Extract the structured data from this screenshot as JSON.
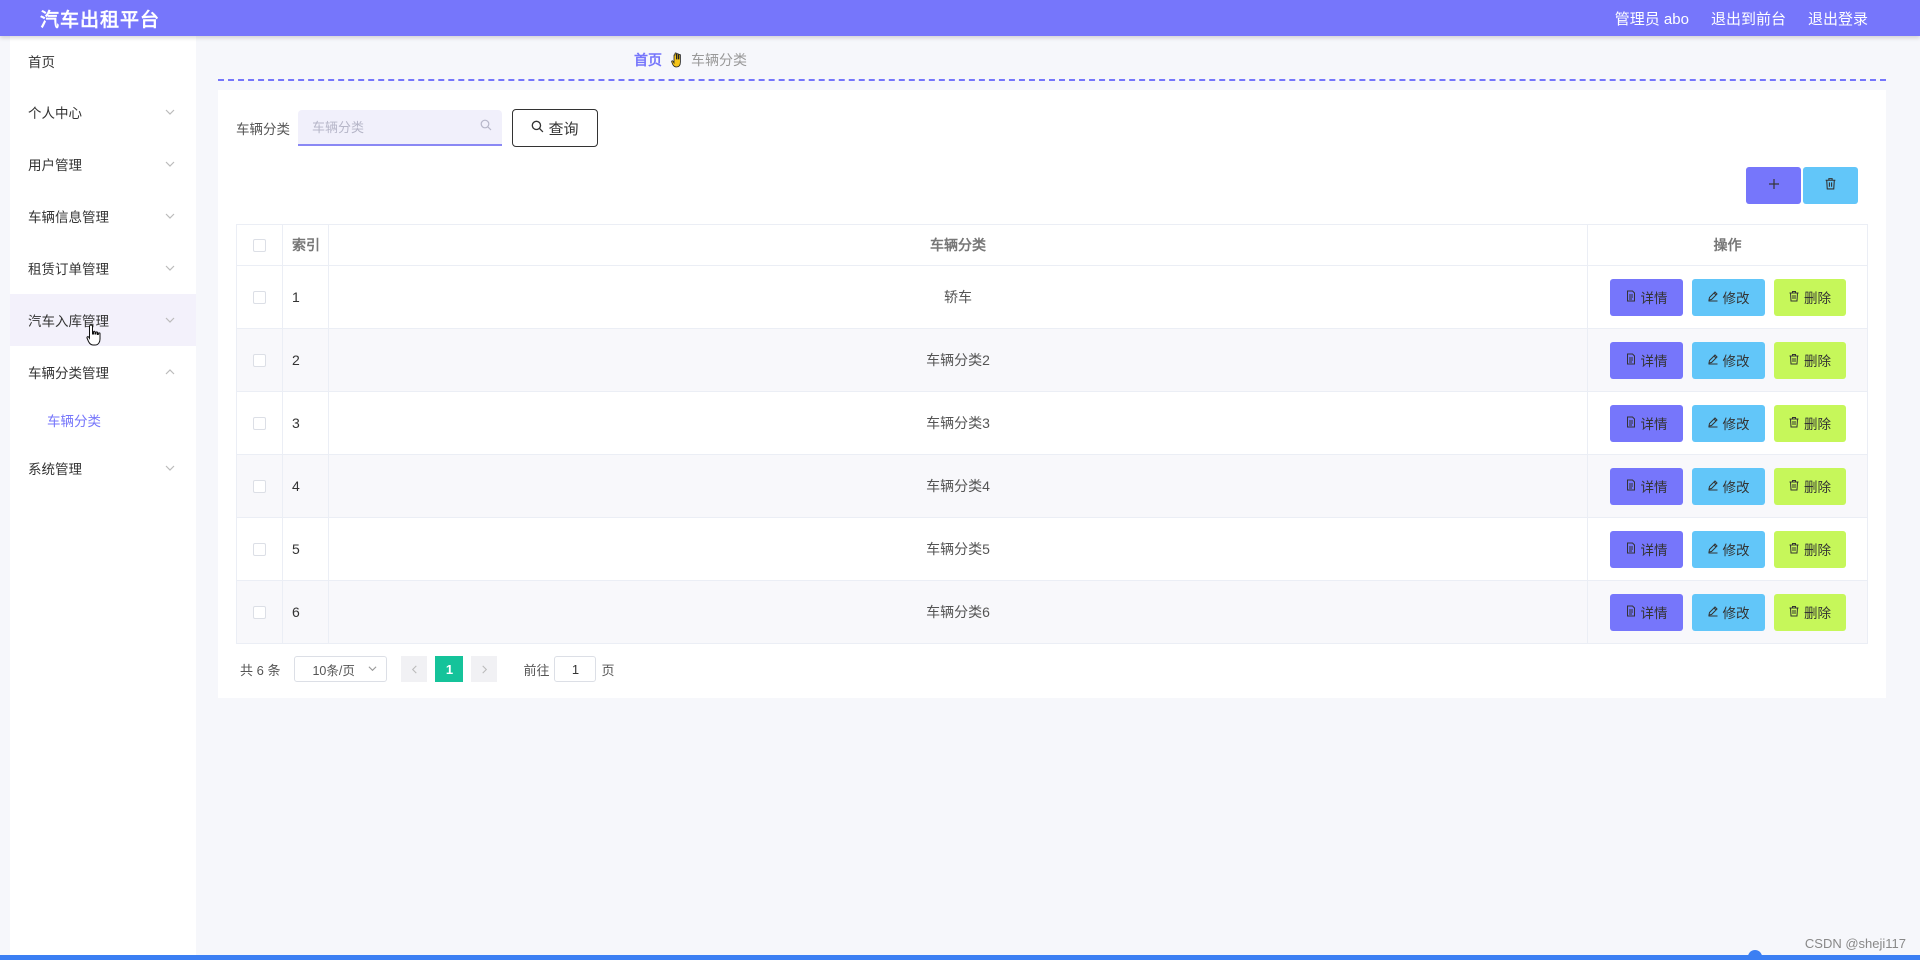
{
  "header": {
    "title": "汽车出租平台",
    "admin": "管理员 abo",
    "to_front": "退出到前台",
    "logout": "退出登录"
  },
  "sidebar": {
    "items": [
      {
        "label": "首页"
      },
      {
        "label": "个人中心"
      },
      {
        "label": "用户管理"
      },
      {
        "label": "车辆信息管理"
      },
      {
        "label": "租赁订单管理"
      },
      {
        "label": "汽车入库管理"
      },
      {
        "label": "车辆分类管理"
      },
      {
        "label": "系统管理"
      }
    ],
    "sub_item": "车辆分类"
  },
  "breadcrumb": {
    "home": "首页",
    "current": "车辆分类"
  },
  "search": {
    "label": "车辆分类",
    "placeholder": "车辆分类",
    "button": "查询"
  },
  "table": {
    "headers": {
      "index": "索引",
      "category": "车辆分类",
      "ops": "操作"
    },
    "rows": [
      {
        "index": "1",
        "category": "轿车"
      },
      {
        "index": "2",
        "category": "车辆分类2"
      },
      {
        "index": "3",
        "category": "车辆分类3"
      },
      {
        "index": "4",
        "category": "车辆分类4"
      },
      {
        "index": "5",
        "category": "车辆分类5"
      },
      {
        "index": "6",
        "category": "车辆分类6"
      }
    ],
    "ops": {
      "detail": "详情",
      "edit": "修改",
      "delete": "删除"
    }
  },
  "pager": {
    "total": "共 6 条",
    "page_size": "10条/页",
    "current": "1",
    "goto_label": "前往",
    "goto_value": "1",
    "page_unit": "页"
  },
  "watermark": "CSDN @sheji117",
  "colors": {
    "primary": "#7676fb",
    "info": "#62c6f9",
    "warning": "#c6f75a",
    "success": "#15c39a"
  }
}
